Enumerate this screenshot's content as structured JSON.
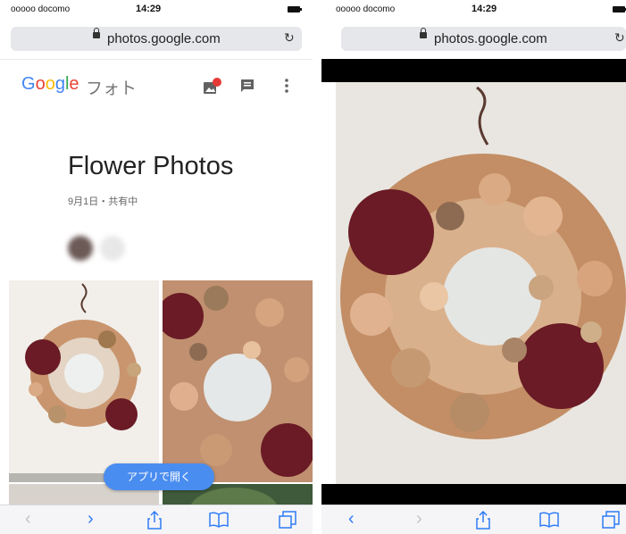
{
  "left_screen": {
    "status": {
      "carrier": "ooooo docomo",
      "time": "14:29"
    },
    "browser": {
      "url": "photos.google.com"
    },
    "app": {
      "logo": "Google",
      "product": "フォト",
      "icons": [
        "add-photo-icon",
        "chat-icon",
        "more-vert-icon"
      ]
    },
    "album": {
      "title": "Flower Photos",
      "subtitle": "9月1日・共有中"
    },
    "open_app_button": "アプリで開く",
    "toolbar": [
      "back-icon",
      "forward-icon",
      "share-icon",
      "bookmarks-icon",
      "tabs-icon"
    ]
  },
  "right_screen": {
    "status": {
      "carrier": "ooooo docomo",
      "time": "14:29"
    },
    "browser": {
      "url": "photos.google.com"
    },
    "toolbar": [
      "back-icon",
      "forward-icon",
      "share-icon",
      "bookmarks-icon",
      "tabs-icon"
    ]
  },
  "colors": {
    "accent": "#4a8df0",
    "notification": "#e53935"
  }
}
